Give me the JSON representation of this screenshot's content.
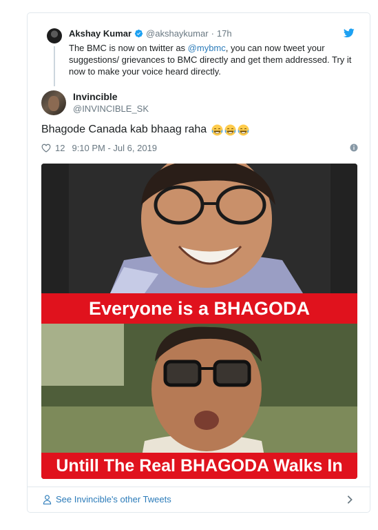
{
  "parent_tweet": {
    "name": "Akshay Kumar",
    "handle": "@akshaykumar",
    "separator": "·",
    "time": "17h",
    "text_before_mention": "The BMC is now on twitter as ",
    "mention": "@mybmc",
    "text_after_mention": ", you can now tweet your suggestions/ grievances to BMC directly and get them addressed. Try it now to make your voice heard directly.",
    "verified_icon": "verified-badge-icon"
  },
  "reply": {
    "name": "Invincible",
    "handle": "@INVINCIBLE_SK",
    "text": "Bhagode Canada kab bhaag raha",
    "emojis": [
      "face-with-tears-of-joy",
      "face-with-tears-of-joy",
      "face-with-tears-of-joy"
    ],
    "like_count": "12",
    "timestamp": "9:10 PM - Jul 6, 2019"
  },
  "meme": {
    "caption_top": "Everyone is a BHAGODA",
    "caption_bottom": "Untill The Real BHAGODA Walks In"
  },
  "footer": {
    "link_text": "See Invincible's other Tweets"
  },
  "colors": {
    "link": "#2b7bb9",
    "secondary_text": "#697882",
    "caption_red": "#e0121d",
    "border": "#e1e8ed"
  }
}
